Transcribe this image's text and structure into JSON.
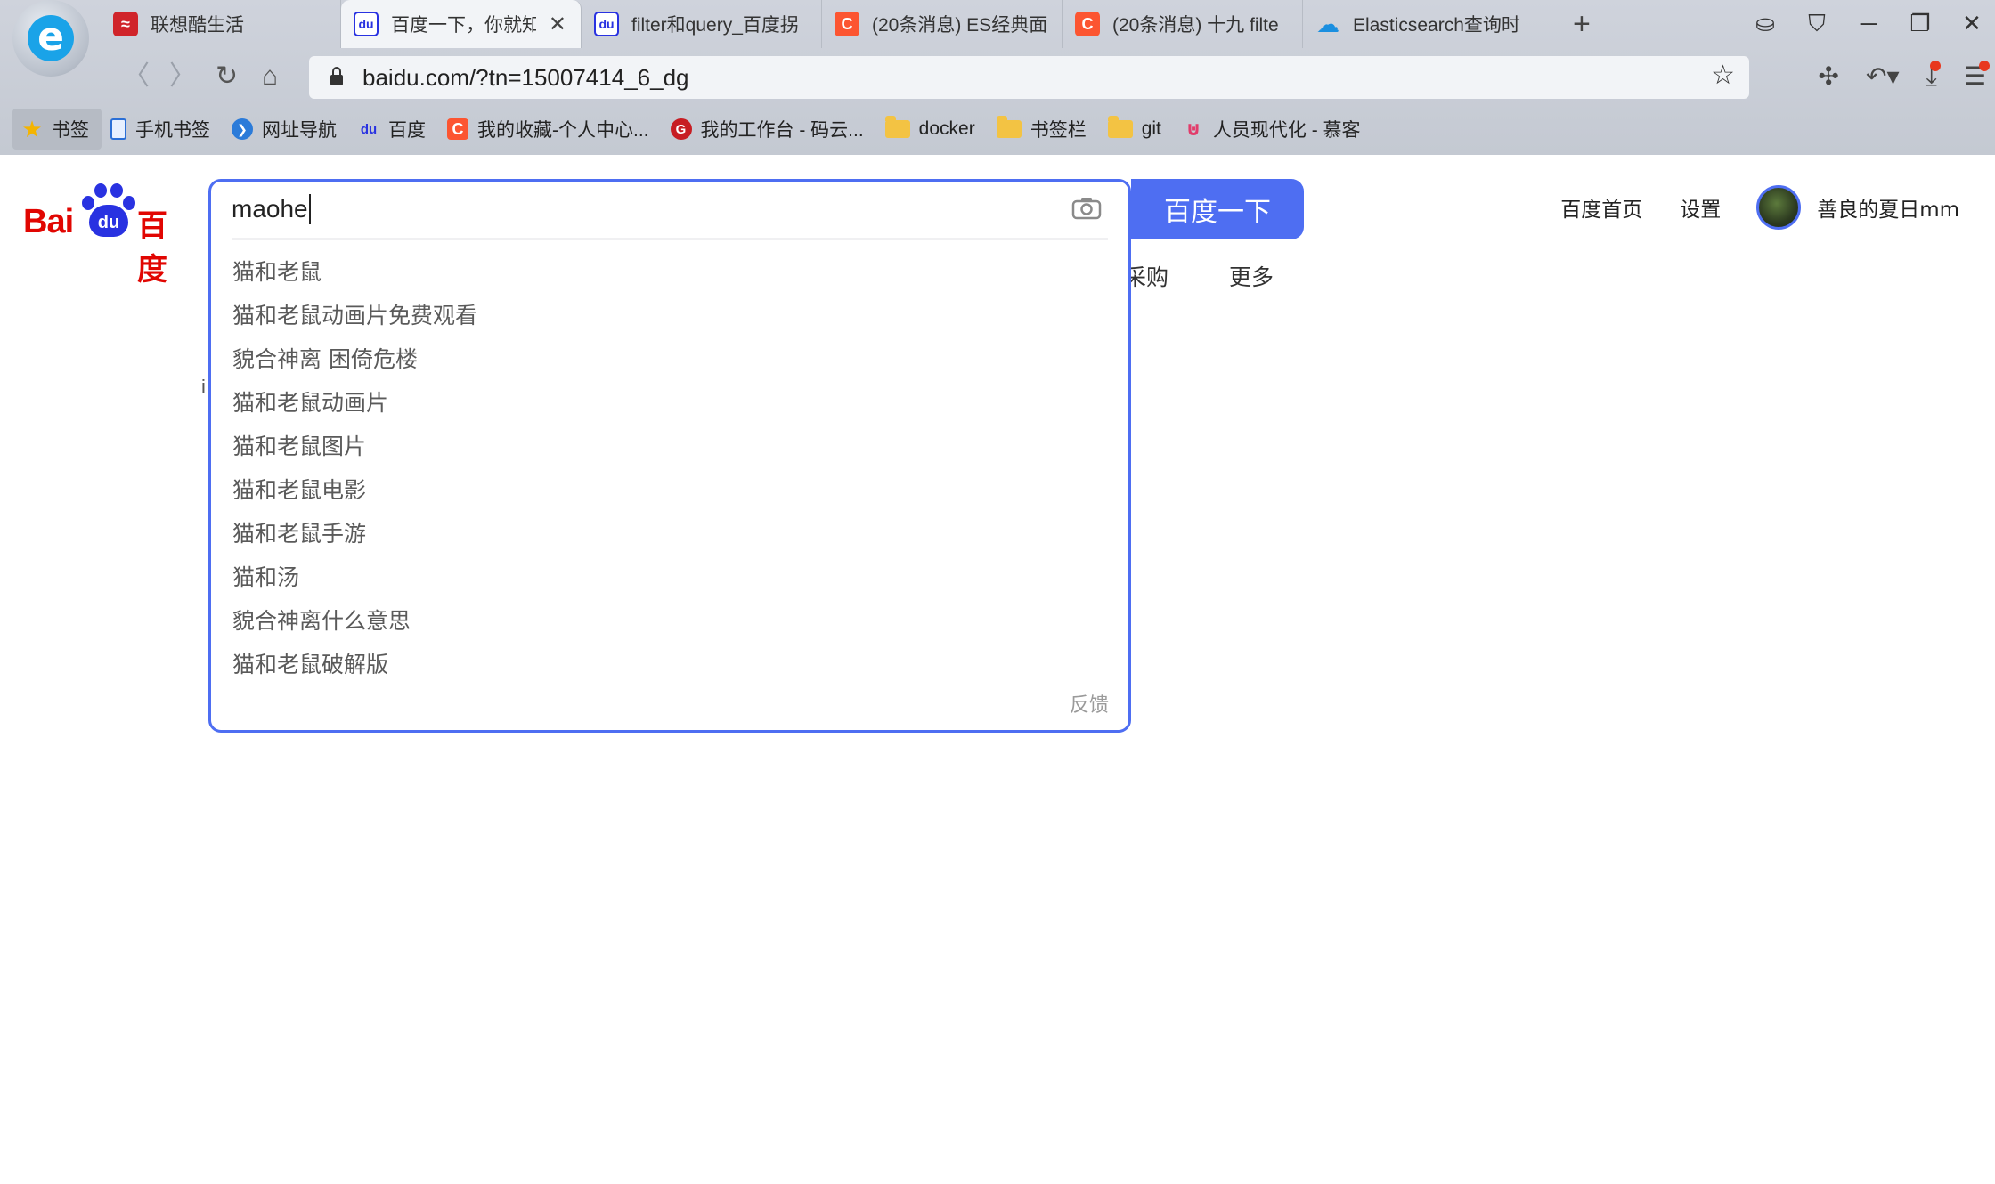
{
  "browser": {
    "tabs": [
      {
        "title": "联想酷生活",
        "favicon": "lenovo-icon",
        "active": false
      },
      {
        "title": "百度一下，你就知",
        "favicon": "baidu-icon",
        "active": true
      },
      {
        "title": "filter和query_百度拐",
        "favicon": "baidu-icon",
        "active": false
      },
      {
        "title": "(20条消息) ES经典面",
        "favicon": "csdn-icon",
        "active": false
      },
      {
        "title": "(20条消息) 十九 filte",
        "favicon": "csdn-icon",
        "active": false
      },
      {
        "title": "Elasticsearch查询时",
        "favicon": "cloud-icon",
        "active": false
      }
    ],
    "url": "baidu.com/?tn=15007414_6_dg",
    "bookmarks": [
      {
        "label": "书签",
        "icon": "star-icon"
      },
      {
        "label": "手机书签",
        "icon": "phone-icon"
      },
      {
        "label": "网址导航",
        "icon": "nav-icon"
      },
      {
        "label": "百度",
        "icon": "baidu-icon"
      },
      {
        "label": "我的收藏-个人中心...",
        "icon": "csdn-icon"
      },
      {
        "label": "我的工作台 - 码云...",
        "icon": "gitee-icon"
      },
      {
        "label": "docker",
        "icon": "folder-icon"
      },
      {
        "label": "书签栏",
        "icon": "folder-icon"
      },
      {
        "label": "git",
        "icon": "folder-icon"
      },
      {
        "label": "人员现代化 - 慕客",
        "icon": "mooc-icon"
      }
    ]
  },
  "page": {
    "search": {
      "value": "maohe",
      "button_label": "百度一下",
      "suggestions": [
        "猫和老鼠",
        "猫和老鼠动画片免费观看",
        "貌合神离 困倚危楼",
        "猫和老鼠动画片",
        "猫和老鼠图片",
        "猫和老鼠电影",
        "猫和老鼠手游",
        "猫和汤",
        "貌合神离什么意思",
        "猫和老鼠破解版"
      ],
      "feedback_label": "反馈"
    },
    "behind_links": {
      "purchase": "采购",
      "more": "更多"
    },
    "header": {
      "home": "百度首页",
      "settings": "设置",
      "username": "善良的夏日mm"
    },
    "colors": {
      "accent": "#4e6ef2",
      "logo_red": "#e10602",
      "logo_blue": "#2932e1"
    }
  }
}
